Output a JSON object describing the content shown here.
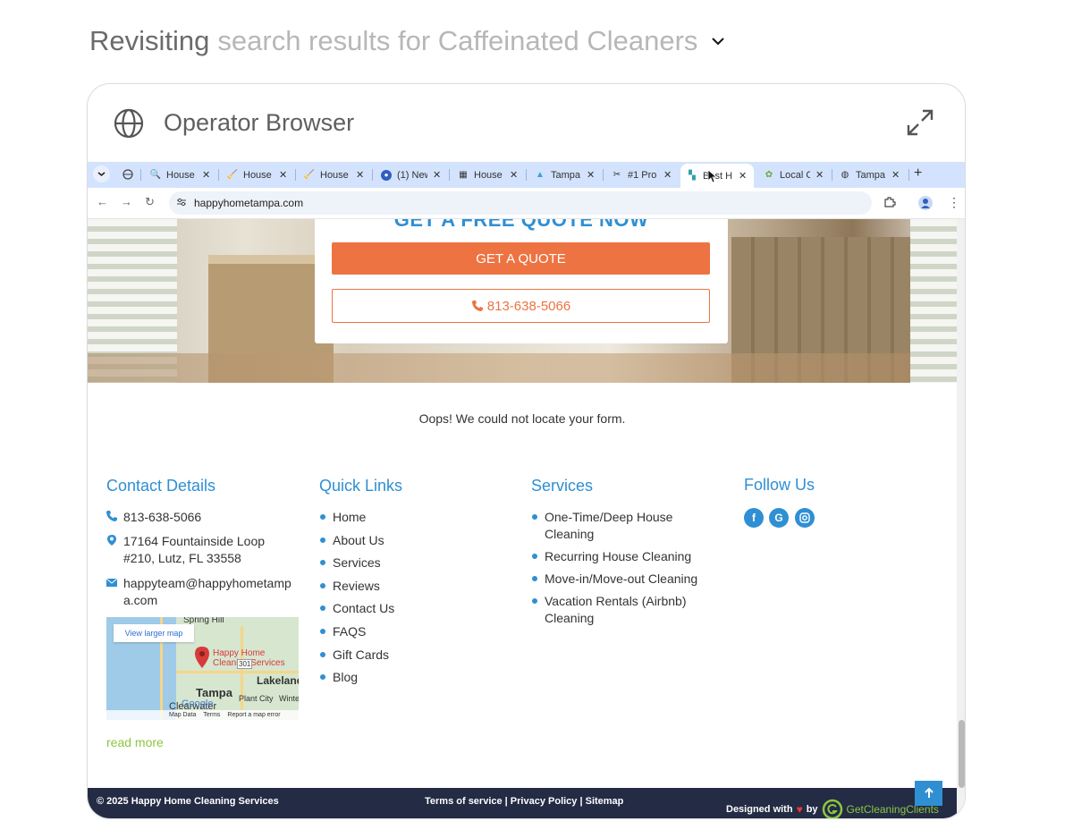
{
  "header": {
    "prefix": "Revisiting",
    "text": "search results for Caffeinated Cleaners"
  },
  "panel": {
    "title": "Operator Browser"
  },
  "tabs": [
    {
      "label": "House",
      "icon": "search-icon"
    },
    {
      "label": "House",
      "icon": "site-icon"
    },
    {
      "label": "House",
      "icon": "site-icon"
    },
    {
      "label": "(1) New",
      "icon": "site-icon"
    },
    {
      "label": "House",
      "icon": "grid-icon"
    },
    {
      "label": "Tampa",
      "icon": "site-icon"
    },
    {
      "label": "#1 Pro",
      "icon": "site-icon"
    },
    {
      "label": "Best H",
      "icon": "site-icon",
      "active": true
    },
    {
      "label": "Local C",
      "icon": "site-icon"
    },
    {
      "label": "Tampa",
      "icon": "globe-icon"
    }
  ],
  "browser": {
    "url": "happyhometampa.com"
  },
  "hero": {
    "quote_heading": "GET A FREE QUOTE NOW",
    "quote_button": "GET A QUOTE",
    "phone_button": "813-638-5066"
  },
  "form_error": "Oops! We could not locate your form.",
  "contact": {
    "title": "Contact Details",
    "phone": "813-638-5066",
    "address": "17164 Fountainside Loop #210, Lutz, FL 33558",
    "email": "happyteam@happyhometampa.com",
    "read_more": "read more"
  },
  "map": {
    "view_larger": "View larger map",
    "pin_label": "Happy Home Cleaning Services",
    "places": [
      "Spring Hill",
      "Tampa",
      "Lakeland",
      "Clearwater",
      "Plant City",
      "Winter"
    ],
    "footer": [
      "Map Data",
      "Terms",
      "Report a map error"
    ],
    "brand": "Google",
    "highway": "301"
  },
  "quick_links": {
    "title": "Quick Links",
    "items": [
      "Home",
      "About Us",
      "Services",
      "Reviews",
      "Contact Us",
      "FAQS",
      "Gift Cards",
      "Blog"
    ]
  },
  "services": {
    "title": "Services",
    "items": [
      "One-Time/Deep House Cleaning",
      "Recurring House Cleaning",
      "Move-in/Move-out Cleaning",
      "Vacation Rentals (Airbnb) Cleaning"
    ]
  },
  "follow": {
    "title": "Follow Us",
    "icons": [
      "facebook-icon",
      "google-icon",
      "instagram-icon"
    ]
  },
  "footer": {
    "copyright": "© 2025 Happy Home Cleaning Services",
    "links": "Terms of service | Privacy Policy | Sitemap",
    "designed_with": "Designed with",
    "by": "by",
    "brand": "GetCleaningClients"
  },
  "colors": {
    "accent_blue": "#2f8fd3",
    "accent_orange": "#ee7342",
    "accent_green": "#8cc63f",
    "footer_bg": "#232b45"
  }
}
